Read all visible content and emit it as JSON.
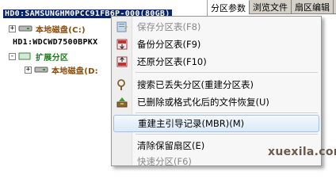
{
  "tree": {
    "rows": [
      {
        "expander": "",
        "text": "HD0:SAMSUNGHM0PCC91FB6P-000(80GB)"
      },
      {
        "expander": "+",
        "text": "本地磁盘(C:)"
      },
      {
        "expander": "",
        "text": "HD1:WDCWD7500BPKX"
      },
      {
        "expander": "-",
        "text": "扩展分区"
      },
      {
        "expander": "+",
        "text": "本地磁盘(D:"
      }
    ]
  },
  "tabs": [
    "分区参数",
    "浏览文件",
    "扇区编辑"
  ],
  "menu": {
    "items": [
      {
        "label": "保存分区表(F8)",
        "icon": "save-table-icon",
        "disabled": true
      },
      {
        "label": "备份分区表(F9)",
        "icon": "backup-table-icon",
        "disabled": false
      },
      {
        "label": "还原分区表(F10)",
        "icon": "restore-table-icon",
        "disabled": false
      },
      {
        "label": "搜索已丢失分区(重建分区表)",
        "icon": "search-icon",
        "disabled": false
      },
      {
        "label": "已删除或格式化后的文件恢复(U)",
        "icon": "recover-files-icon",
        "disabled": false
      },
      {
        "label": "重建主引导记录(MBR)(M)",
        "icon": "",
        "disabled": false,
        "highlighted": true
      },
      {
        "label": "清除保留扇区(E)",
        "icon": "",
        "disabled": false
      },
      {
        "label": "快速分区(F6)",
        "icon": "",
        "disabled": true
      }
    ]
  },
  "watermark": "xuexila.com"
}
